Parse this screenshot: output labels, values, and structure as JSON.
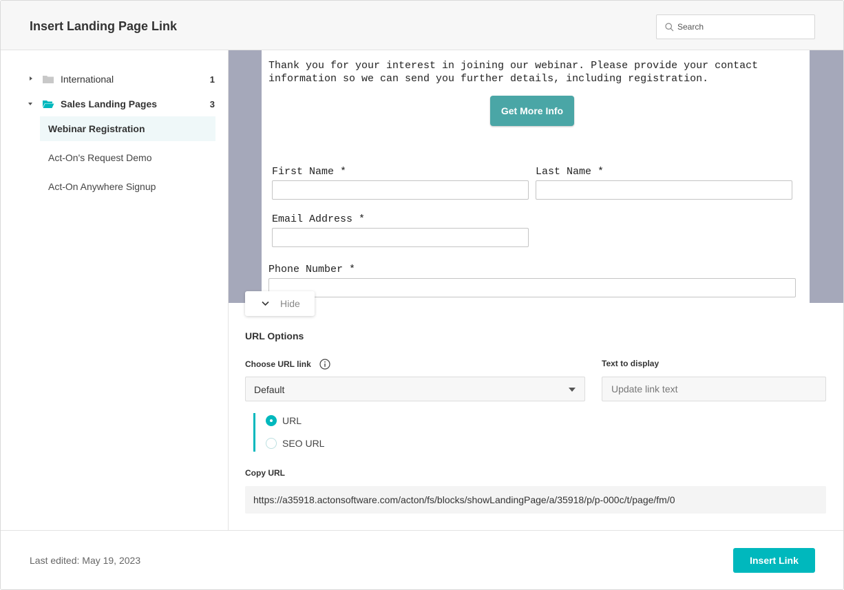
{
  "header": {
    "title": "Insert Landing Page Link",
    "search_placeholder": "Search"
  },
  "sidebar": {
    "folders": [
      {
        "label": "International",
        "count": "1",
        "expanded": false
      },
      {
        "label": "Sales Landing Pages",
        "count": "3",
        "expanded": true
      }
    ],
    "pages": [
      {
        "label": "Webinar Registration",
        "selected": true
      },
      {
        "label": "Act-On's Request Demo",
        "selected": false
      },
      {
        "label": "Act-On Anywhere Signup",
        "selected": false
      }
    ]
  },
  "preview": {
    "intro_text": "Thank you for your interest in joining our webinar. Please provide your contact information so we can send you further details, including registration.",
    "cta_label": "Get More Info",
    "fields": {
      "first_name": "First Name *",
      "last_name": "Last Name *",
      "email": "Email Address *",
      "phone": "Phone Number *"
    }
  },
  "hide_toggle": {
    "label": "Hide"
  },
  "url_options": {
    "title": "URL Options",
    "choose_label": "Choose URL link",
    "select_value": "Default",
    "text_display_label": "Text to display",
    "text_display_placeholder": "Update link text",
    "radio_options": [
      {
        "label": "URL",
        "checked": true
      },
      {
        "label": "SEO URL",
        "checked": false
      }
    ],
    "copy_url_label": "Copy URL",
    "copy_url_value": "https://a35918.actonsoftware.com/acton/fs/blocks/showLandingPage/a/35918/p/p-000c/t/page/fm/0"
  },
  "footer": {
    "last_edited": "Last edited: May 19, 2023",
    "insert_label": "Insert Link"
  },
  "colors": {
    "accent": "#00b8bd",
    "cta": "#4aa6a6",
    "preview_backdrop": "#a5a8ba",
    "selected_row": "#eff8f9"
  },
  "icons": [
    "search-icon",
    "folder-icon",
    "folder-open-icon",
    "chevron-down-icon",
    "info-icon",
    "caret-right-icon",
    "caret-down-icon"
  ]
}
